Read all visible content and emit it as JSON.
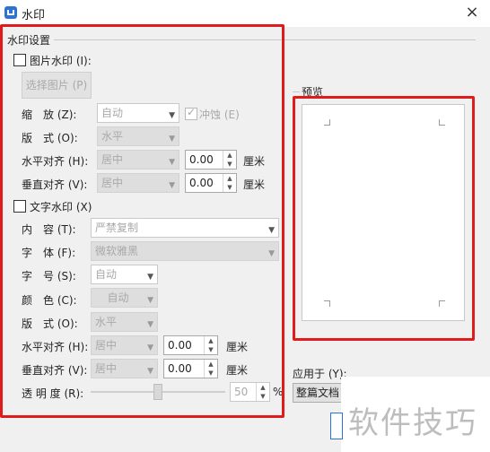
{
  "window": {
    "title": "水印",
    "close": "×"
  },
  "settings_group": {
    "label": "水印设置"
  },
  "picture": {
    "checkbox_label": "图片水印 (I):",
    "checked": false,
    "select_button": "选择图片 (P)",
    "scale_label": "缩　放 (Z):",
    "scale_value": "自动",
    "erode_label": "冲蚀 (E)",
    "erode_checked": true,
    "layout_label": "版　式 (O):",
    "layout_value": "水平",
    "halign_label": "水平对齐 (H):",
    "halign_value": "居中",
    "halign_offset": "0.00",
    "valign_label": "垂直对齐 (V):",
    "valign_value": "居中",
    "valign_offset": "0.00",
    "unit": "厘米"
  },
  "text": {
    "checkbox_label": "文字水印 (X)",
    "checked": false,
    "content_label": "内　容 (T):",
    "content_value": "严禁复制",
    "font_label": "字　体 (F):",
    "font_value": "微软雅黑",
    "size_label": "字　号 (S):",
    "size_value": "自动",
    "color_label": "颜　色 (C):",
    "color_value": "自动",
    "layout_label": "版　式 (O):",
    "layout_value": "水平",
    "halign_label": "水平对齐 (H):",
    "halign_value": "居中",
    "halign_offset": "0.00",
    "valign_label": "垂直对齐 (V):",
    "valign_value": "居中",
    "valign_offset": "0.00",
    "unit": "厘米",
    "transparency_label": "透 明 度 (R):",
    "transparency_value": "50",
    "transparency_unit": "%"
  },
  "preview": {
    "label": "预览"
  },
  "apply": {
    "label": "应用于 (Y):",
    "value": "整篇文档"
  },
  "overlay": {
    "text": "软件技巧"
  },
  "colors": {
    "highlight": "#e01b1b",
    "accent": "#2b73d6"
  }
}
